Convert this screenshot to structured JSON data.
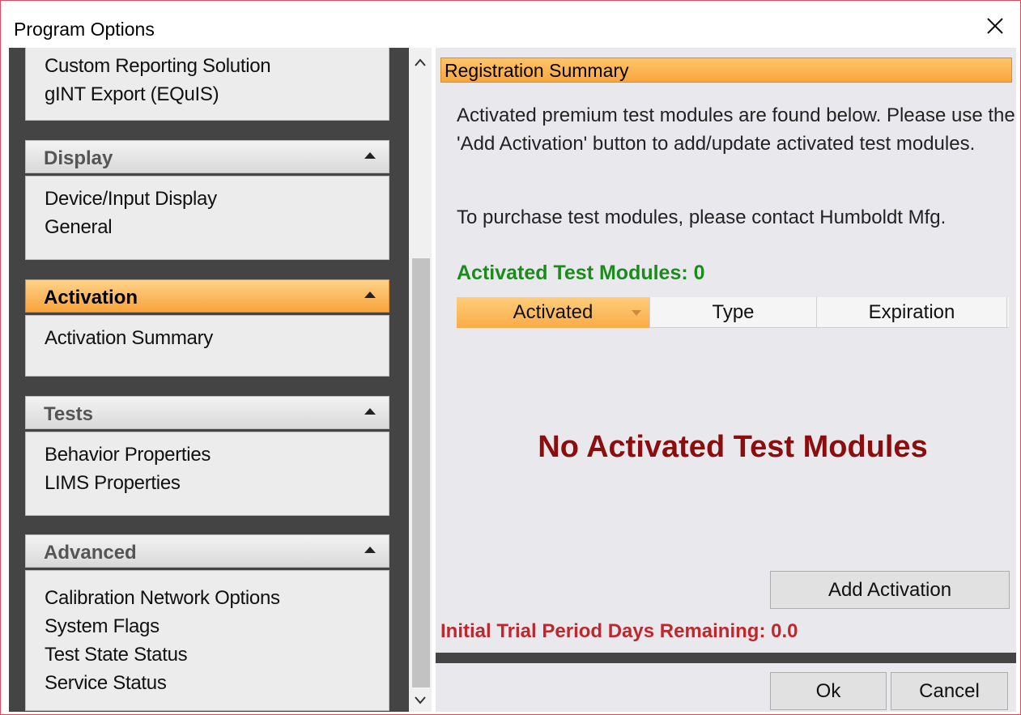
{
  "window": {
    "title": "Program Options",
    "colors": {
      "accent_orange": "#f9a63e",
      "green_text": "#1d8a1d",
      "dark_red": "#8b0e0e",
      "red_text": "#c0272d",
      "nav_bg": "#444444"
    }
  },
  "sidebar": {
    "top_group_items": [
      "Custom Reporting Solution",
      "gINT Export (EQuIS)"
    ],
    "groups": [
      {
        "label": "Display",
        "active": false,
        "items": [
          "Device/Input Display",
          "General"
        ]
      },
      {
        "label": "Activation",
        "active": true,
        "items": [
          "Activation Summary"
        ]
      },
      {
        "label": "Tests",
        "active": false,
        "items": [
          "Behavior Properties",
          "LIMS Properties"
        ]
      },
      {
        "label": "Advanced",
        "active": false,
        "items": [
          "Calibration Network Options",
          "System Flags",
          "Test State Status",
          "Service Status"
        ]
      }
    ]
  },
  "main": {
    "header": "Registration Summary",
    "intro": "Activated premium test modules are found below.  Please use the 'Add Activation' button to add/update activated test modules.",
    "purchase": "To purchase test modules, please contact Humboldt Mfg.",
    "modules_count": "Activated Test Modules:  0",
    "columns": [
      "Activated",
      "Type",
      "Expiration"
    ],
    "empty_message": "No Activated Test Modules",
    "add_activation_label": "Add Activation",
    "trial": "Initial Trial Period Days Remaining:  0.0"
  },
  "footer": {
    "ok_label": "Ok",
    "cancel_label": "Cancel"
  }
}
